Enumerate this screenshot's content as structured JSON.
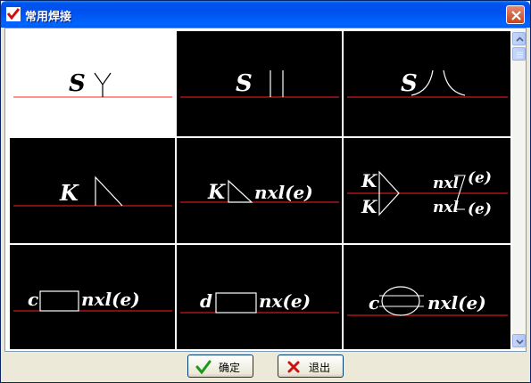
{
  "window": {
    "title": "常用焊接"
  },
  "cells": [
    {
      "label": "S"
    },
    {
      "label": "S"
    },
    {
      "label": "S"
    },
    {
      "label": "K"
    },
    {
      "label": "K",
      "text": "nxl(e)"
    },
    {
      "label_top": "K",
      "label_bottom": "K",
      "text_top_nx": "nxl",
      "text_top_e": "(e)",
      "text_bottom_nx": "nxl",
      "text_bottom_e": "(e)"
    },
    {
      "label": "c",
      "text": "nxl(e)"
    },
    {
      "label": "d",
      "text": "nx(e)"
    },
    {
      "label": "c",
      "text": "nxl(e)"
    }
  ],
  "buttons": {
    "ok": "确定",
    "exit": "退出"
  },
  "colors": {
    "weld_line": "#ff2020",
    "symbol": "#ffffff"
  }
}
